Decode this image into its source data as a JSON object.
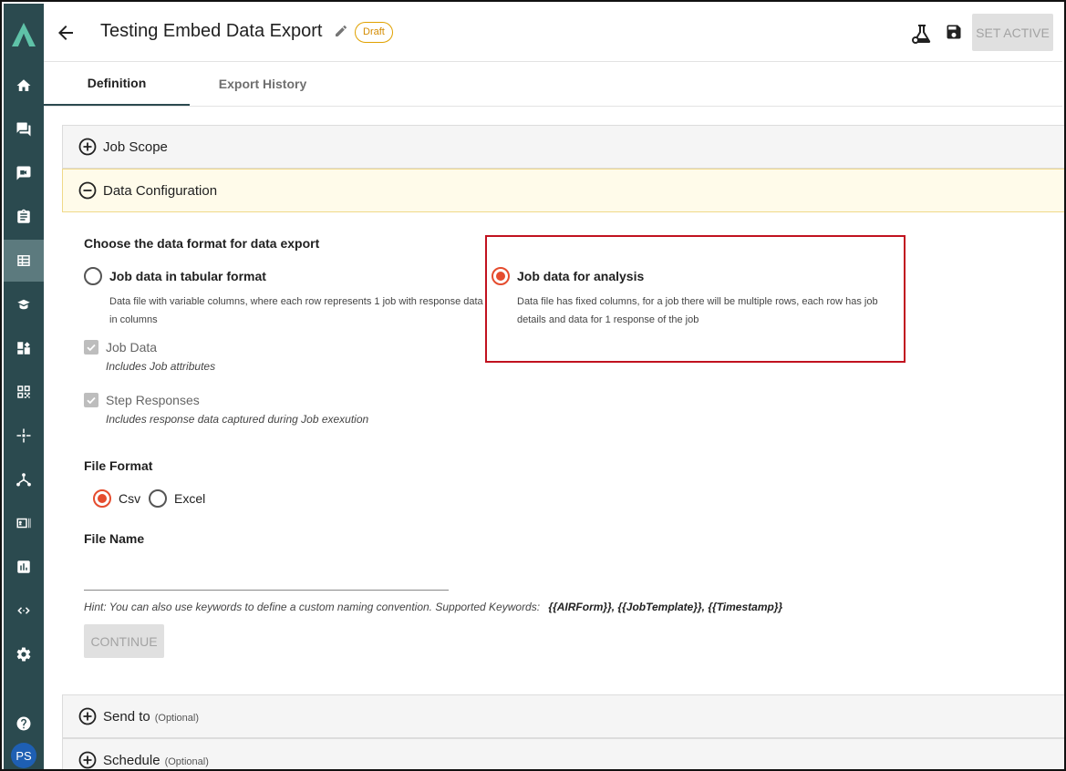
{
  "header": {
    "title": "Testing Embed Data Export",
    "status_badge": "Draft",
    "set_active_label": "SET ACTIVE"
  },
  "tabs": [
    {
      "label": "Definition",
      "active": true
    },
    {
      "label": "Export History",
      "active": false
    }
  ],
  "sidebar": {
    "items": [
      "home-icon",
      "chat-icon",
      "video-icon",
      "clipboard-icon",
      "data-export-icon",
      "learn-icon",
      "dashboard-icon",
      "qr-code-icon",
      "network-icon",
      "hierarchy-icon",
      "id-card-icon",
      "report-icon",
      "code-icon",
      "settings-icon"
    ],
    "active_item": "data-export-icon",
    "help_icon": "help-icon",
    "avatar_initials": "PS"
  },
  "panels": {
    "job_scope": {
      "label": "Job Scope",
      "expanded": false
    },
    "data_configuration": {
      "label": "Data Configuration",
      "expanded": true
    },
    "send_to": {
      "label": "Send to",
      "optional": "(Optional)",
      "expanded": false
    },
    "schedule": {
      "label": "Schedule",
      "optional": "(Optional)",
      "expanded": false
    }
  },
  "data_format": {
    "heading": "Choose the data format for data export",
    "options": [
      {
        "label": "Job data in tabular format",
        "description_line1": "Data file with variable columns, where each row represents 1 job with response data",
        "description_line2": "in columns",
        "selected": false
      },
      {
        "label": "Job data for analysis",
        "description_line1": "Data file has fixed columns, for a job there will be multiple rows, each row has job",
        "description_line2": "details and data for 1 response of the job",
        "selected": true
      }
    ],
    "checkboxes": [
      {
        "label": "Job Data",
        "sublabel": "Includes Job attributes",
        "checked": true,
        "disabled": true
      },
      {
        "label": "Step Responses",
        "sublabel": "Includes response data captured during Job exexution",
        "checked": true,
        "disabled": true
      }
    ]
  },
  "file_format": {
    "heading": "File Format",
    "options": [
      {
        "label": "Csv",
        "selected": true
      },
      {
        "label": "Excel",
        "selected": false
      }
    ]
  },
  "file_name": {
    "heading": "File Name",
    "value": "",
    "hint": "Hint: You can also use keywords to define a custom naming convention. Supported Keywords:",
    "keywords": "{{AIRForm}}, {{JobTemplate}}, {{Timestamp}}"
  },
  "continue_label": "CONTINUE",
  "colors": {
    "sidebar": "#2b4a4f",
    "accent_radio": "#e54c2e",
    "highlight_border": "#c1121f",
    "draft_badge": "#d48b00"
  }
}
